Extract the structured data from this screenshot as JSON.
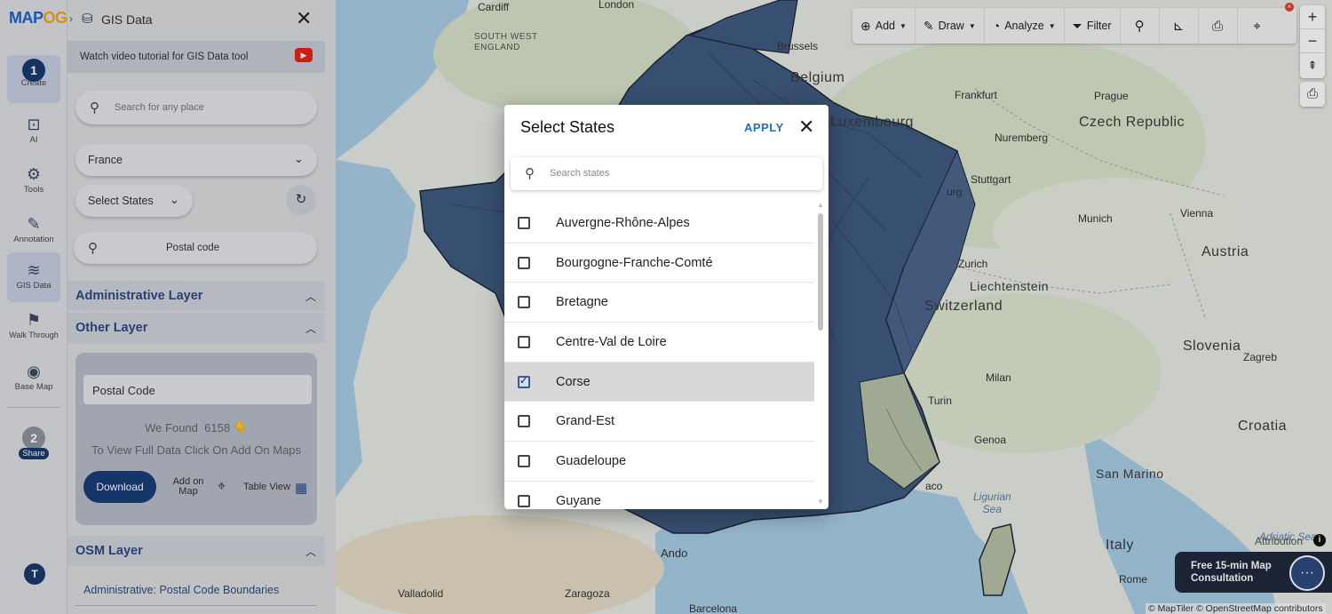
{
  "rail": {
    "logo_main": "MAP",
    "logo_accent": "OG",
    "create": {
      "step": "1",
      "label": "Create"
    },
    "items": [
      {
        "label": "AI",
        "icon": "ai-icon"
      },
      {
        "label": "Tools",
        "icon": "gear-icon"
      },
      {
        "label": "Annotation",
        "icon": "paint-bucket-icon"
      },
      {
        "label": "GIS Data",
        "icon": "layers-icon"
      },
      {
        "label": "Walk Through",
        "icon": "stairs-icon"
      },
      {
        "label": "Base Map",
        "icon": "map-pin-icon"
      }
    ],
    "share": {
      "step": "2",
      "label": "Share"
    },
    "user_initial": "T"
  },
  "panel": {
    "title": "GIS Data",
    "tutorial_text": "Watch video tutorial for GIS Data tool",
    "place_search_placeholder": "Search for any place",
    "country_value": "France",
    "states_label": "Select States",
    "postal_search_label": "Postal code",
    "sections": {
      "administrative": "Administrative Layer",
      "other": "Other Layer",
      "osm": "OSM Layer"
    },
    "card": {
      "input_value": "Postal Code",
      "found_prefix": "We Found",
      "found_count": "6158",
      "found_emoji": "👇",
      "view_full": "To View Full Data Click On Add On Maps",
      "download": "Download",
      "add_on_map": "Add on Map",
      "table_view": "Table View"
    },
    "osm_item": "Administrative: Postal Code Boundaries"
  },
  "map": {
    "toolbar": {
      "add": "Add",
      "draw": "Draw",
      "analyze": "Analyze",
      "filter": "Filter"
    },
    "places": {
      "cardiff": "Cardiff",
      "london": "London",
      "south_west_england": "SOUTH WEST\nENGLAND",
      "brussels": "Brussels",
      "belgium": "Belgium",
      "frankfurt": "Frankfurt",
      "prague": "Prague",
      "czech_republic": "Czech Republic",
      "luxembourg": "Luxembourg",
      "nuremberg": "Nuremberg",
      "stuttgart": "Stuttgart",
      "strasbourg_frag": "urg",
      "munich": "Munich",
      "vienna": "Vienna",
      "zurich": "Zurich",
      "liechtenstein": "Liechtenstein",
      "austria": "Austria",
      "switzerland": "Switzerland",
      "slovenia": "Slovenia",
      "zagreb": "Zagreb",
      "milan": "Milan",
      "turin": "Turin",
      "croatia": "Croatia",
      "genoa": "Genoa",
      "san_marino": "San Marino",
      "monaco_frag": "aco",
      "ligurian_sea": "Ligurian\nSea",
      "andorra_frag": "Ando",
      "italy": "Italy",
      "adriatic_frag": "Adriatic Sea",
      "rome": "Rome",
      "valladolid": "Valladolid",
      "zaragoza": "Zaragoza",
      "barcelona": "Barcelona"
    },
    "attribution_label": "Attribution",
    "consult_line1": "Free 15-min Map",
    "consult_line2": "Consultation",
    "credits": "© MapTiler © OpenStreetMap contributors"
  },
  "modal": {
    "title": "Select States",
    "apply": "APPLY",
    "search_placeholder": "Search states",
    "states": [
      {
        "name": "Auvergne-Rhône-Alpes",
        "checked": false
      },
      {
        "name": "Bourgogne-Franche-Comté",
        "checked": false
      },
      {
        "name": "Bretagne",
        "checked": false
      },
      {
        "name": "Centre-Val de Loire",
        "checked": false
      },
      {
        "name": "Corse",
        "checked": true
      },
      {
        "name": "Grand-Est",
        "checked": false
      },
      {
        "name": "Guadeloupe",
        "checked": false
      },
      {
        "name": "Guyane",
        "checked": false
      }
    ]
  },
  "colors": {
    "accent": "#1a3b6d",
    "link": "#1f6fc9",
    "section_text": "#2d4a85",
    "region_fill": "#3f5a80"
  }
}
